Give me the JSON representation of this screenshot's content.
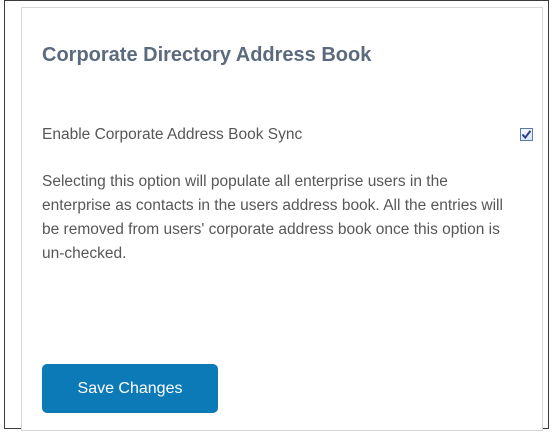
{
  "section": {
    "title": "Corporate Directory Address Book"
  },
  "sync_option": {
    "label": "Enable Corporate Address Book Sync",
    "checked": true,
    "icon": "checkmark-icon"
  },
  "description": "Selecting this option will populate all enterprise users in the enterprise as contacts in the users address book. All the entries will be removed from users' corporate address book once this option is un-checked.",
  "actions": {
    "save_label": "Save Changes"
  },
  "colors": {
    "title": "#5b6b7d",
    "button": "#0d7ab8",
    "checkmark": "#2a3f8f"
  }
}
